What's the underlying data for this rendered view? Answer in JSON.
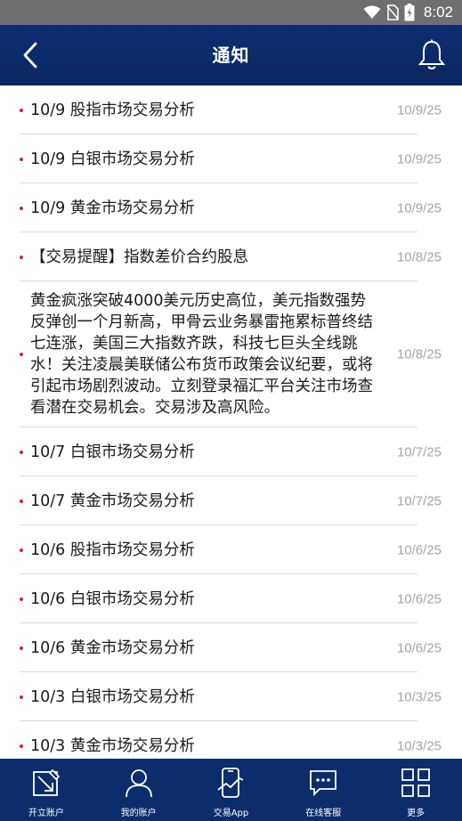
{
  "status_bar": {
    "time": "8:02"
  },
  "header": {
    "title": "通知",
    "back_icon": "chevron-left-icon",
    "bell_icon": "bell-icon"
  },
  "notifications": [
    {
      "text": "10/9 股指市场交易分析",
      "date": "10/9/25"
    },
    {
      "text": "10/9 白银市场交易分析",
      "date": "10/9/25"
    },
    {
      "text": "10/9 黄金市场交易分析",
      "date": "10/9/25"
    },
    {
      "text": "【交易提醒】指数差价合约股息",
      "date": "10/8/25"
    },
    {
      "text": "黄金疯涨突破4000美元历史高位，美元指数强势反弹创一个月新高，甲骨云业务暴雷拖累标普终结七连涨，美国三大指数齐跌，科技七巨头全线跳水！关注凌晨美联储公布货币政策会议纪要，或将引起市场剧烈波动。立刻登录福汇平台关注市场查看潜在交易机会。交易涉及高风险。",
      "date": "10/8/25"
    },
    {
      "text": "10/7 白银市场交易分析",
      "date": "10/7/25"
    },
    {
      "text": "10/7 黄金市场交易分析",
      "date": "10/7/25"
    },
    {
      "text": "10/6 股指市场交易分析",
      "date": "10/6/25"
    },
    {
      "text": "10/6 白银市场交易分析",
      "date": "10/6/25"
    },
    {
      "text": "10/6 黄金市场交易分析",
      "date": "10/6/25"
    },
    {
      "text": "10/3 白银市场交易分析",
      "date": "10/3/25"
    },
    {
      "text": "10/3 黄金市场交易分析",
      "date": "10/3/25"
    }
  ],
  "bottom_nav": [
    {
      "label": "开立账户",
      "icon": "open-account-icon"
    },
    {
      "label": "我的账户",
      "icon": "user-icon"
    },
    {
      "label": "交易App",
      "icon": "trading-app-icon"
    },
    {
      "label": "在线客服",
      "icon": "chat-icon"
    },
    {
      "label": "更多",
      "icon": "grid-icon"
    }
  ],
  "colors": {
    "header_bg": "#0b2d6b",
    "dot": "#d8232a",
    "date": "#a5a5a5",
    "status_bar": "#6f6f6f"
  }
}
